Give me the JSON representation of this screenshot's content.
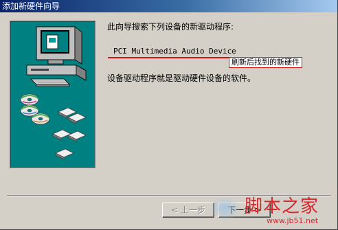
{
  "window": {
    "title": "添加新硬件向导"
  },
  "wizard": {
    "intro": "此向导搜索下列设备的新驱动程序:",
    "device_name": "PCI Multimedia Audio Device",
    "annotation": "刷新后找到的新硬件",
    "description": "设备驱动程序就是驱动硬件设备的软件。"
  },
  "buttons": {
    "back_label": "< 上一步",
    "next_label": "下一步 >"
  },
  "watermark": {
    "main": "脚本之家",
    "sub": "www.jb51.net"
  },
  "colors": {
    "title_start": "#0a246a",
    "title_end": "#a6caf0",
    "art_bg": "#008080",
    "annotation": "#e01010",
    "watermark": "#d8262c"
  }
}
